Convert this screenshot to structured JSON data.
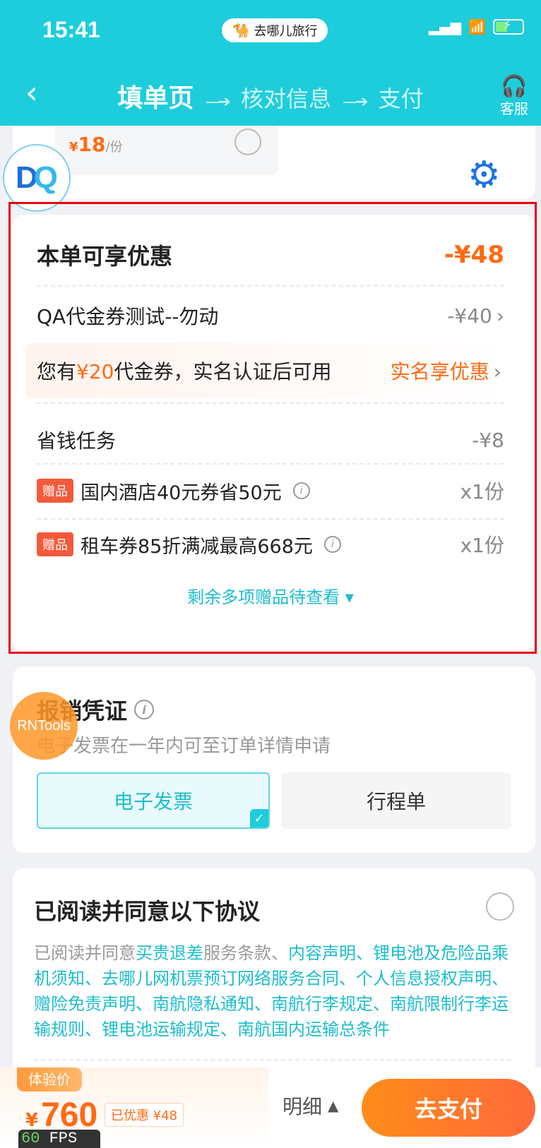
{
  "status_bar": {
    "time": "15:41",
    "brand": "去哪儿旅行"
  },
  "nav": {
    "step_current": "填单页",
    "step_2": "核对信息",
    "step_3": "支付",
    "service_label": "客服"
  },
  "top_card": {
    "price_symbol": "¥",
    "price_value": "18",
    "price_unit": "/份"
  },
  "floating": {
    "rntools_label": "RNTools",
    "dq_logo_d": "D",
    "dq_logo_q": "Q"
  },
  "discount": {
    "title": "本单可享优惠",
    "total": "-¥48",
    "coupon_label": "QA代金券测试--勿动",
    "coupon_value": "-¥40",
    "verify_prefix": "您有",
    "verify_amount": "¥20",
    "verify_suffix": "代金券，实名认证后可用",
    "verify_link": "实名享优惠",
    "task_label": "省钱任务",
    "task_value": "-¥8",
    "gifts": [
      {
        "badge": "赠品",
        "label": "国内酒店40元券省50元",
        "qty": "x1份"
      },
      {
        "badge": "赠品",
        "label": "租车券85折满减最高668元",
        "qty": "x1份"
      }
    ],
    "more_gifts": "剩余多项赠品待查看"
  },
  "invoice": {
    "title": "报销凭证",
    "subtitle": "电子发票在一年内可至订单详情申请",
    "option_selected": "电子发票",
    "option_other": "行程单"
  },
  "agreement": {
    "title": "已阅读并同意以下协议",
    "prefix": "已阅读并同意",
    "link_1": "买贵退差",
    "text_1": "服务条款、",
    "links": "内容声明、锂电池及危险品乘机须知、去哪儿网机票预订网络服务合同、个人信息授权声明、赠险免责声明、南航隐私通知、南航行李规定、南航限制行李运输规则、锂电池运输规定、南航国内运输总条件"
  },
  "bottom": {
    "tag": "体验价",
    "price_symbol": "¥",
    "price": "760",
    "saved": "已优惠 ¥48",
    "fps_num": "60",
    "fps_label": " FPS",
    "detail": "明细",
    "pay": "去支付"
  },
  "colors": {
    "brand": "#1dcddc",
    "accent": "#ff6a12",
    "outline": "#e60012"
  }
}
